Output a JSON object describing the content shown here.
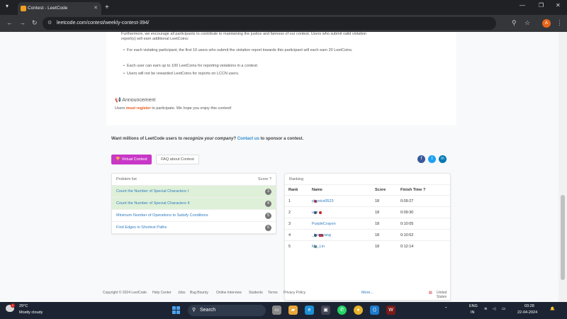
{
  "browser": {
    "tab_title": "Contest - LeetCode",
    "url": "leetcode.com/contest/weekly-contest-394/",
    "profile_initial": "A"
  },
  "rules": {
    "intro": "Furthermore, we encourage all participants to contribute to maintaining the justice and fairness of our contest. Users who submit valid violation report(s) will earn additional LeetCoins:",
    "bullets": [
      "For each violating participant, the first 10 users who submit the violation report towards this participant will each earn 20 LeetCoins.",
      "Each user can earn up to 100 LeetCoins for reporting violations in a contest.",
      "Users will not be rewarded LeetCoins for reports on LCCN users."
    ]
  },
  "announcement": {
    "title": "Announcement",
    "pre": "Users ",
    "highlight": "must register",
    "post": " to participate. We hope you enjoy this contest!"
  },
  "sponsor": {
    "pre": "Want millions of LeetCode users to ",
    "emph": "recognize your company",
    "mid": "? ",
    "link": "Contact us",
    "post": " to sponsor a contest."
  },
  "buttons": {
    "virtual": "Virtual Contest",
    "faq": "FAQ about Contest"
  },
  "problems": {
    "header": "Problem list",
    "score_header": "Score",
    "items": [
      {
        "title": "Count the Number of Special Characters I",
        "score": "3",
        "solved": true
      },
      {
        "title": "Count the Number of Special Characters II",
        "score": "4",
        "solved": true
      },
      {
        "title": "Minimum Number of Operations to Satisfy Conditions",
        "score": "5",
        "solved": false
      },
      {
        "title": "Find Edges in Shortest Paths",
        "score": "6",
        "solved": false
      }
    ]
  },
  "ranking": {
    "header": "Ranking",
    "columns": [
      "Rank",
      "Name",
      "Score",
      "Finish Time"
    ],
    "rows": [
      {
        "rank": "1",
        "name": "physics0523",
        "score": "18",
        "time": "0:09:27"
      },
      {
        "rank": "2",
        "name": "uwi",
        "score": "18",
        "time": "0:09:30"
      },
      {
        "rank": "3",
        "name": "PurpleCrayon",
        "score": "18",
        "time": "0:10:05"
      },
      {
        "rank": "4",
        "name": "_kennyang",
        "score": "18",
        "time": "0:10:52"
      },
      {
        "rank": "5",
        "name": "Ma_Lin",
        "score": "18",
        "time": "0:12:14"
      }
    ],
    "more": "More..."
  },
  "footer": {
    "copyright": "Copyright © 2024 LeetCode",
    "links": [
      "Help Center",
      "Jobs",
      "Bug Bounty",
      "Online Interview",
      "Students",
      "Terms",
      "Privacy Policy"
    ],
    "region": "United States"
  },
  "taskbar": {
    "temp": "29°C",
    "weather": "Mostly cloudy",
    "search": "Search",
    "lang_top": "ENG",
    "lang_bottom": "IN",
    "time": "03:28",
    "date": "22-04-2024"
  }
}
